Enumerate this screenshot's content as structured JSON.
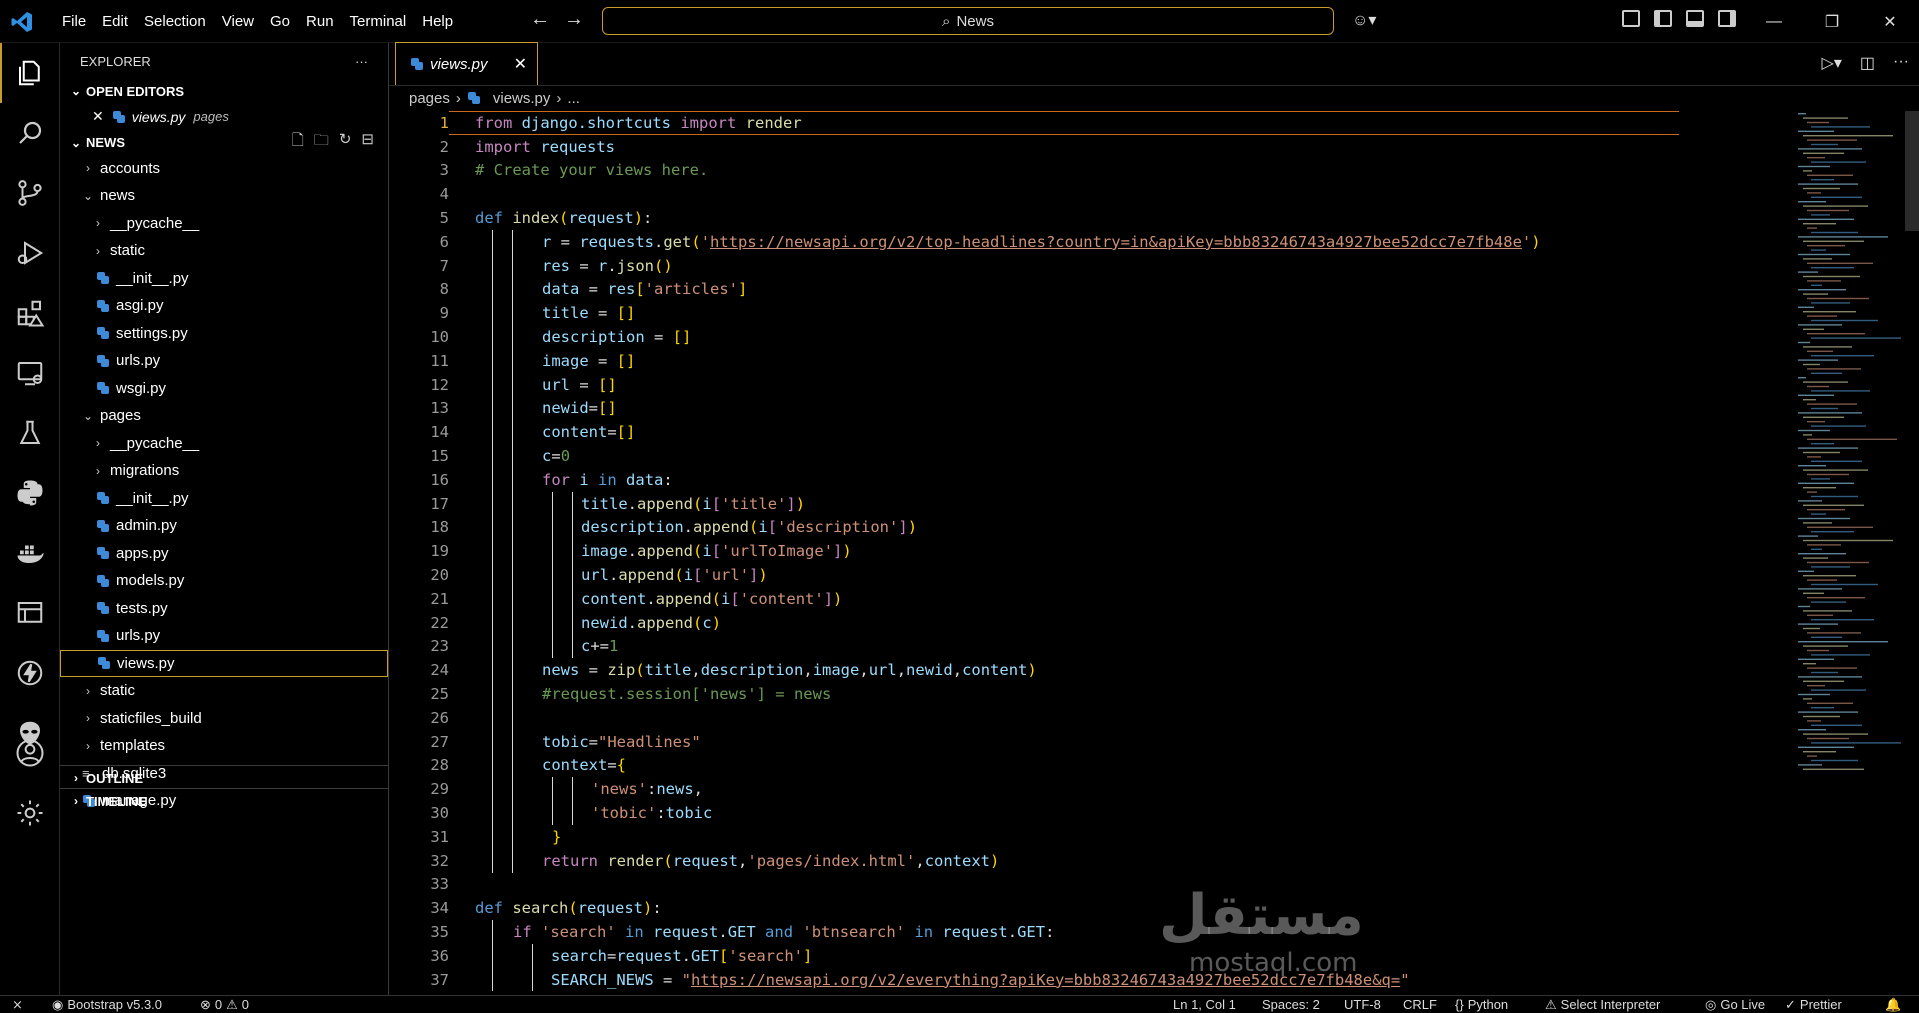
{
  "titlebar": {
    "menu": [
      "File",
      "Edit",
      "Selection",
      "View",
      "Go",
      "Run",
      "Terminal",
      "Help"
    ],
    "search_text": "News",
    "controls": [
      "minimize",
      "restore",
      "close"
    ]
  },
  "activity": [
    "explorer-icon",
    "search-icon",
    "source-control-icon",
    "run-debug-icon",
    "extensions-icon",
    "remote-explorer-icon",
    "testing-icon",
    "python-icon",
    "docker-icon",
    "database-icon",
    "thunder-client-icon",
    "alien-icon",
    "account-icon",
    "settings-gear-icon"
  ],
  "sidebar": {
    "title": "EXPLORER",
    "open_editors_label": "OPEN EDITORS",
    "open_editor": {
      "name": "views.py",
      "folder": "pages"
    },
    "project_label": "NEWS",
    "tree": [
      {
        "label": "accounts",
        "type": "folder",
        "depth": 0,
        "open": false
      },
      {
        "label": "news",
        "type": "folder",
        "depth": 0,
        "open": true
      },
      {
        "label": "__pycache__",
        "type": "folder",
        "depth": 1,
        "open": false
      },
      {
        "label": "static",
        "type": "folder",
        "depth": 1,
        "open": false
      },
      {
        "label": "__init__.py",
        "type": "py",
        "depth": 1
      },
      {
        "label": "asgi.py",
        "type": "py",
        "depth": 1
      },
      {
        "label": "settings.py",
        "type": "py",
        "depth": 1
      },
      {
        "label": "urls.py",
        "type": "py",
        "depth": 1
      },
      {
        "label": "wsgi.py",
        "type": "py",
        "depth": 1
      },
      {
        "label": "pages",
        "type": "folder",
        "depth": 0,
        "open": true
      },
      {
        "label": "__pycache__",
        "type": "folder",
        "depth": 1,
        "open": false
      },
      {
        "label": "migrations",
        "type": "folder",
        "depth": 1,
        "open": false
      },
      {
        "label": "__init__.py",
        "type": "py",
        "depth": 1
      },
      {
        "label": "admin.py",
        "type": "py",
        "depth": 1
      },
      {
        "label": "apps.py",
        "type": "py",
        "depth": 1
      },
      {
        "label": "models.py",
        "type": "py",
        "depth": 1
      },
      {
        "label": "tests.py",
        "type": "py",
        "depth": 1
      },
      {
        "label": "urls.py",
        "type": "py",
        "depth": 1
      },
      {
        "label": "views.py",
        "type": "py",
        "depth": 1,
        "selected": true
      },
      {
        "label": "static",
        "type": "folder",
        "depth": 0,
        "open": false
      },
      {
        "label": "staticfiles_build",
        "type": "folder",
        "depth": 0,
        "open": false
      },
      {
        "label": "templates",
        "type": "folder",
        "depth": 0,
        "open": false
      },
      {
        "label": "db.sqlite3",
        "type": "db",
        "depth": 0
      },
      {
        "label": "manage.py",
        "type": "py",
        "depth": 0
      }
    ],
    "outline_label": "OUTLINE",
    "timeline_label": "TIMELINE"
  },
  "editor": {
    "tab_label": "views.py",
    "breadcrumb": [
      "pages",
      "views.py",
      "..."
    ],
    "current_line": 1,
    "watermark": "مستقل",
    "watermark_sub": "mostaql.com"
  },
  "statusbar": {
    "bootstrap": "Bootstrap v5.3.0",
    "errors": "0",
    "warnings": "0",
    "position": "Ln 1, Col 1",
    "spaces": "Spaces: 2",
    "encoding": "UTF-8",
    "eol": "CRLF",
    "language": "Python",
    "interpreter": "Select Interpreter",
    "golive": "Go Live",
    "prettier": "Prettier"
  }
}
